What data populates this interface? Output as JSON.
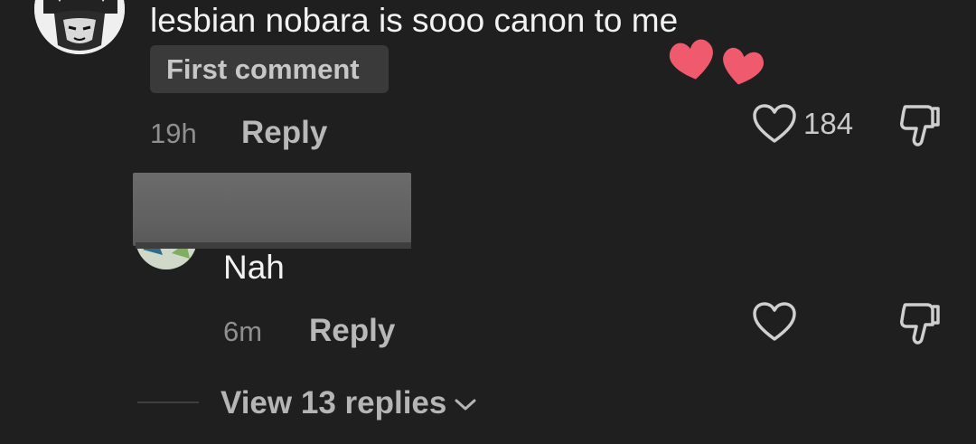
{
  "comment": {
    "text": "lesbian nobara is sooo canon to me",
    "badge": "First comment",
    "time": "19h",
    "reply_label": "Reply",
    "like_count": "184"
  },
  "reply": {
    "text": "Nah",
    "time": "6m",
    "reply_label": "Reply"
  },
  "view_replies": {
    "label": "View 13 replies"
  },
  "icons": {
    "like": "heart-outline-icon",
    "dislike": "thumbs-down-icon",
    "expand": "chevron-down-icon",
    "reaction": "hearts-sticker"
  },
  "colors": {
    "background": "#1f1f1f",
    "heart_sticker": "#ef5a6e",
    "badge_bg": "#3a3a3a"
  }
}
